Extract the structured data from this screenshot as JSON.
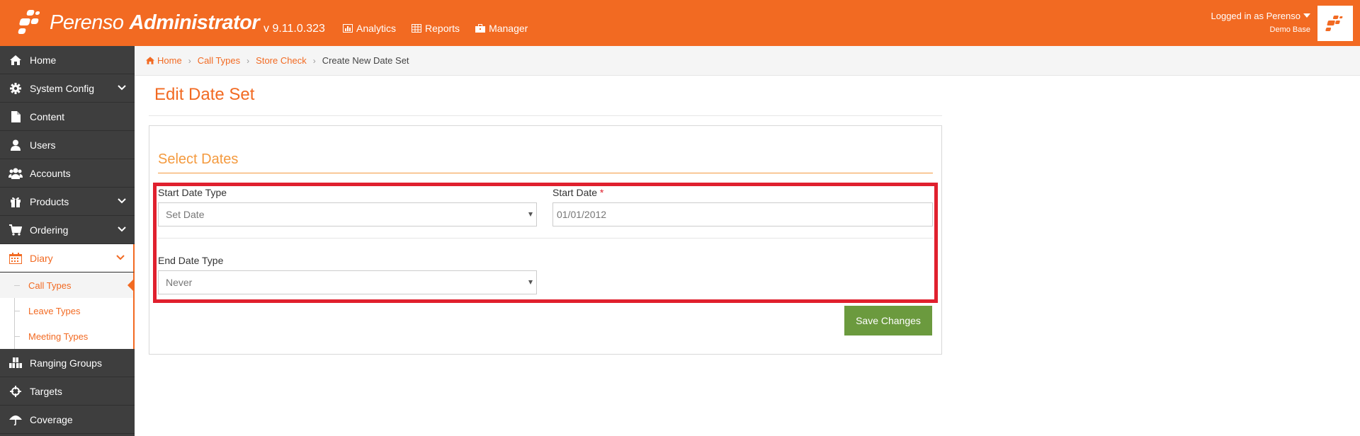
{
  "header": {
    "brand_regular": "Perenso",
    "brand_bold": "Administrator",
    "version": "v 9.11.0.323",
    "nav": [
      {
        "label": "Analytics",
        "icon": "chart-icon"
      },
      {
        "label": "Reports",
        "icon": "table-icon"
      },
      {
        "label": "Manager",
        "icon": "briefcase-icon"
      }
    ],
    "user_text": "Logged in as Perenso",
    "user_sub": "Demo Base"
  },
  "sidebar": {
    "items": [
      {
        "label": "Home",
        "icon": "home-icon"
      },
      {
        "label": "System Config",
        "icon": "gear-icon"
      },
      {
        "label": "Content",
        "icon": "file-icon"
      },
      {
        "label": "Users",
        "icon": "user-icon"
      },
      {
        "label": "Accounts",
        "icon": "users-icon"
      },
      {
        "label": "Products",
        "icon": "gift-icon"
      },
      {
        "label": "Ordering",
        "icon": "cart-icon"
      },
      {
        "label": "Diary",
        "icon": "calendar-icon"
      },
      {
        "label": "Ranging Groups",
        "icon": "cubes-icon"
      },
      {
        "label": "Targets",
        "icon": "crosshairs-icon"
      },
      {
        "label": "Coverage",
        "icon": "umbrella-icon"
      }
    ],
    "diary_subitems": [
      "Call Types",
      "Leave Types",
      "Meeting Types"
    ]
  },
  "breadcrumb": [
    "Home",
    "Call Types",
    "Store Check",
    "Create New Date Set"
  ],
  "page": {
    "title": "Edit Date Set",
    "section_title": "Select Dates",
    "start_date_type_label": "Start Date Type",
    "start_date_type_value": "Set Date",
    "start_date_label": "Start Date",
    "required_marker": "*",
    "start_date_value": "01/01/2012",
    "end_date_type_label": "End Date Type",
    "end_date_type_value": "Never",
    "save_label": "Save Changes"
  },
  "colors": {
    "brand": "#f26a22",
    "section": "#f49a3e",
    "sidebar": "#3e3e3e",
    "save": "#6b9a3e",
    "highlight": "#e0202e"
  }
}
